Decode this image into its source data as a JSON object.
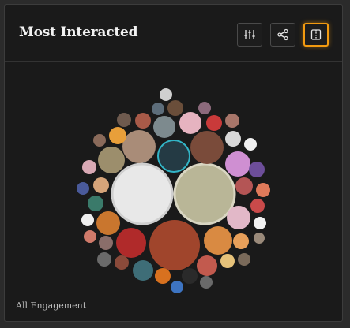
{
  "header": {
    "title": "Most Interacted",
    "buttons": [
      {
        "name": "filter-button",
        "icon": "sliders-icon"
      },
      {
        "name": "share-button",
        "icon": "share-icon"
      },
      {
        "name": "split-view-button",
        "icon": "split-view-icon",
        "active": true
      }
    ]
  },
  "footer": {
    "label": "All Engagement"
  },
  "colors": {
    "accent": "#f29a10",
    "background": "#1a1a1a",
    "text": "#f2f2f2"
  }
}
